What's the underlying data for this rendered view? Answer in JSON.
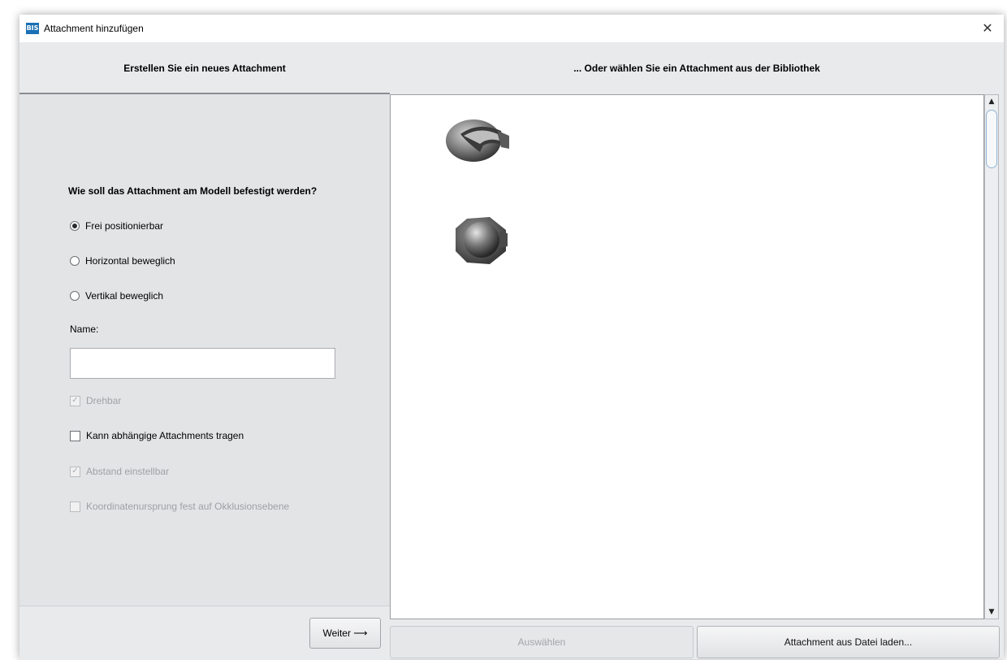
{
  "window": {
    "title": "Attachment hinzufügen",
    "app_icon": "app-logo-icon",
    "app_icon_text": "BIS",
    "close_symbol": "✕",
    "accent": "#1a6fb5"
  },
  "left_panel": {
    "header": "Erstellen Sie ein neues Attachment",
    "question": "Wie soll das Attachment am Modell befestigt werden?",
    "mount_options": [
      {
        "label": "Frei positionierbar",
        "selected": true
      },
      {
        "label": "Horizontal beweglich",
        "selected": false
      },
      {
        "label": "Vertikal beweglich",
        "selected": false
      }
    ],
    "name_label": "Name:",
    "name_value": "",
    "checkboxes": [
      {
        "label": "Drehbar",
        "checked": true,
        "enabled": false
      },
      {
        "label": "Kann abhängige Attachments tragen",
        "checked": false,
        "enabled": true
      },
      {
        "label": "Abstand einstellbar",
        "checked": true,
        "enabled": false
      },
      {
        "label": "Koordinatenursprung fest auf Okklusionsebene",
        "checked": false,
        "enabled": false
      }
    ],
    "next_button": "Weiter ⟶"
  },
  "right_panel": {
    "header": "... Oder wählen Sie ein Attachment aus der Bibliothek",
    "library_items": [
      {
        "icon": "attachment-thumbnail-icon"
      },
      {
        "icon": "attachment-ball-thumbnail-icon"
      }
    ],
    "scroll_up": "▲",
    "scroll_down": "▼",
    "select_button": "Auswählen",
    "select_enabled": false,
    "load_button": "Attachment aus Datei laden..."
  }
}
